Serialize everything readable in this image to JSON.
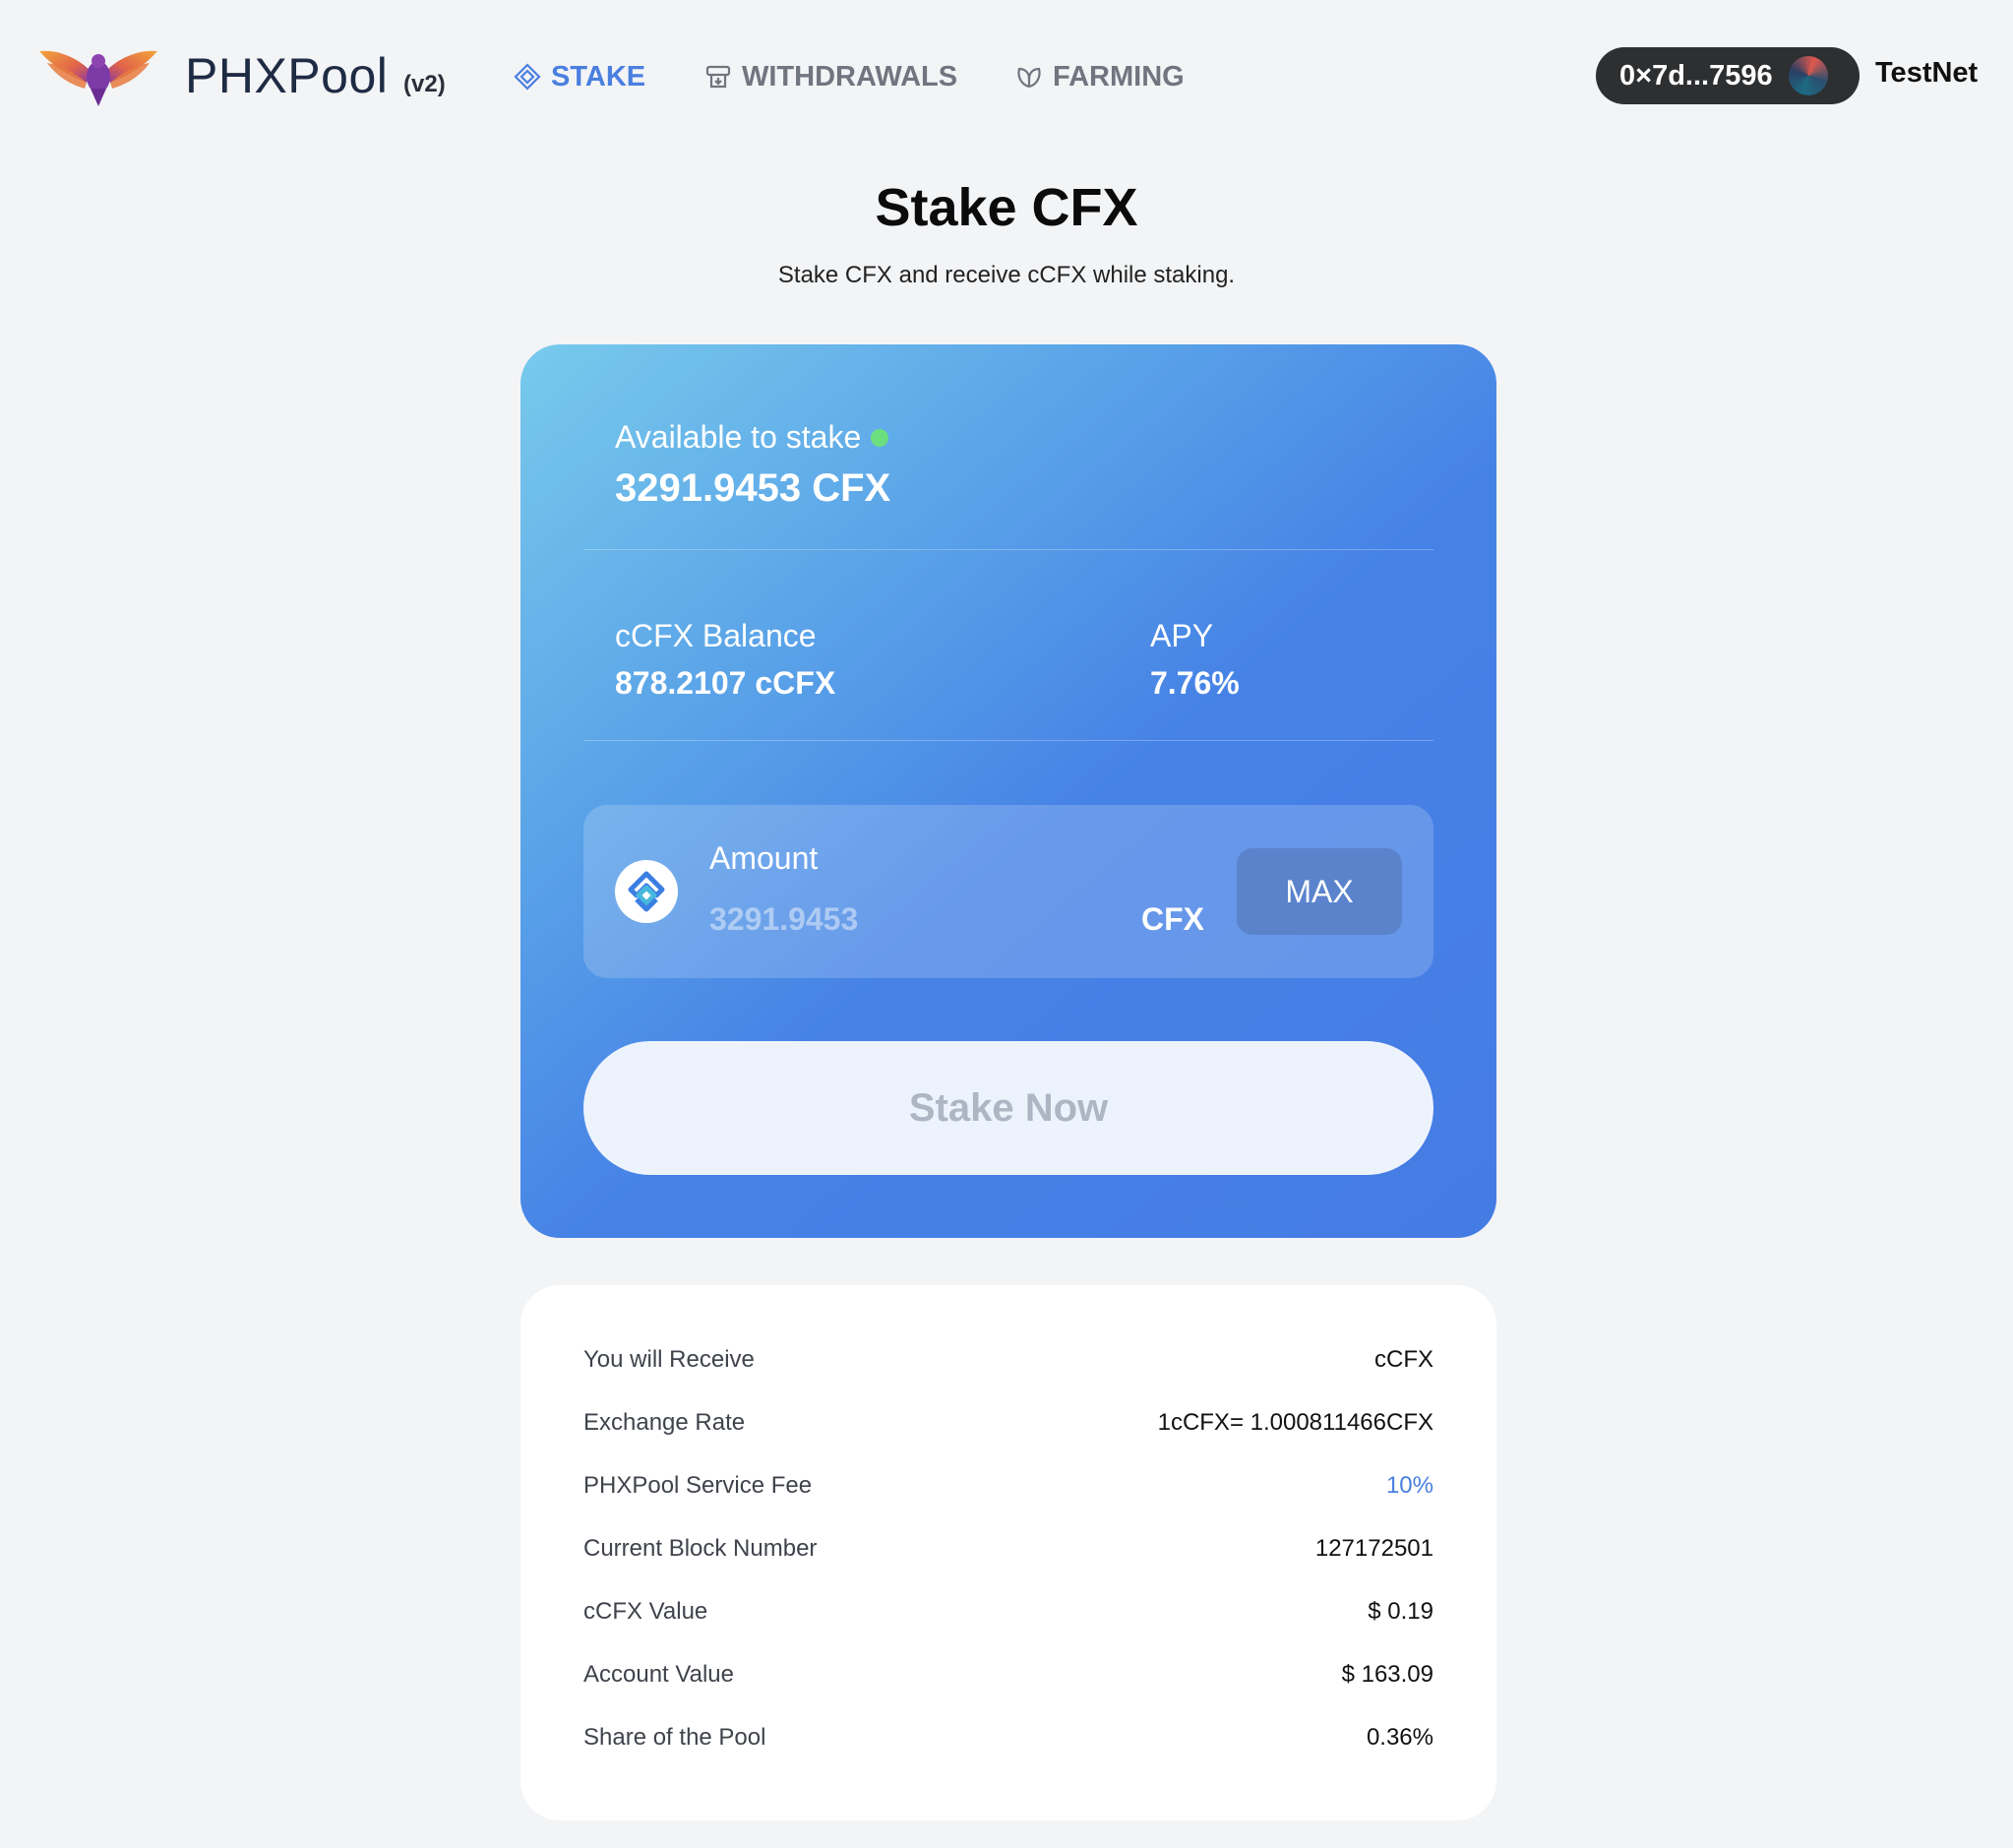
{
  "header": {
    "brand": "PHXPool",
    "version": "(v2)",
    "nav": [
      {
        "label": "STAKE",
        "icon": "stake-diamond-icon",
        "active": true
      },
      {
        "label": "WITHDRAWALS",
        "icon": "withdraw-icon",
        "active": false
      },
      {
        "label": "FARMING",
        "icon": "leaf-icon",
        "active": false
      }
    ],
    "wallet_address": "0×7d...7596",
    "network": "TestNet"
  },
  "page": {
    "title": "Stake CFX",
    "subtitle": "Stake CFX and receive cCFX while staking."
  },
  "stake_card": {
    "available_label": "Available to stake",
    "available_value": "3291.9453 CFX",
    "balance_label": "cCFX Balance",
    "balance_value": "878.2107 cCFX",
    "apy_label": "APY",
    "apy_value": "7.76%",
    "amount_label": "Amount",
    "amount_placeholder": "3291.9453",
    "amount_unit": "CFX",
    "max_label": "MAX",
    "stake_button": "Stake Now"
  },
  "info": {
    "rows": [
      {
        "label": "You will Receive",
        "value": "cCFX"
      },
      {
        "label": "Exchange Rate",
        "value": "1cCFX= 1.000811466CFX"
      },
      {
        "label": "PHXPool Service Fee",
        "value": "10%"
      },
      {
        "label": "Current Block Number",
        "value": "127172501"
      },
      {
        "label": "cCFX Value",
        "value": "$ 0.19"
      },
      {
        "label": "Account Value",
        "value": "$ 163.09"
      },
      {
        "label": "Share of the Pool",
        "value": "0.36%"
      }
    ]
  },
  "colors": {
    "accent": "#4a7fe0",
    "status_online": "#6bdf7e",
    "wallet_pill": "#2d2f31"
  }
}
